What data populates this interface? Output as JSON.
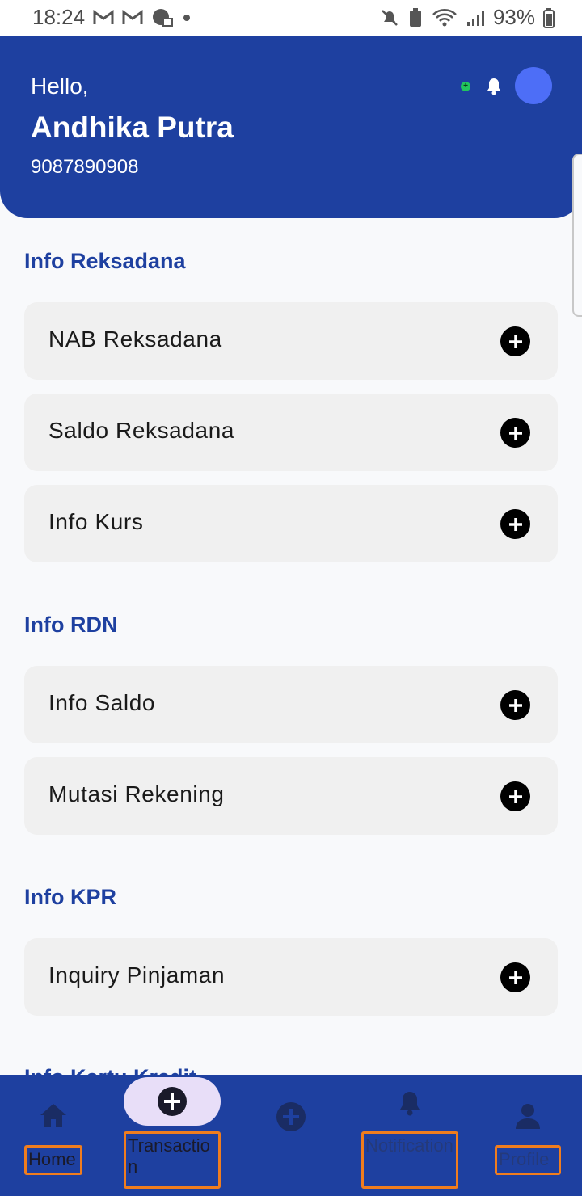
{
  "status_bar": {
    "time": "18:24",
    "battery": "93%",
    "left_icons": [
      "gmail-icon",
      "gmail-icon",
      "chat-icon",
      "dot-icon"
    ],
    "right_icons": [
      "mute-icon",
      "battery-saver-icon",
      "wifi-icon",
      "signal-icon",
      "battery-icon"
    ]
  },
  "header": {
    "greeting": "Hello,",
    "user_name": "Andhika Putra",
    "account_number": "9087890908",
    "colors": {
      "background": "#1e40a0",
      "avatar": "#4d6ef7",
      "online_dot": "#22c55e"
    }
  },
  "sections": [
    {
      "title": "Info Reksadana",
      "items": [
        "NAB Reksadana",
        "Saldo Reksadana",
        "Info Kurs"
      ]
    },
    {
      "title": "Info RDN",
      "items": [
        "Info Saldo",
        "Mutasi Rekening"
      ]
    },
    {
      "title": "Info KPR",
      "items": [
        "Inquiry Pinjaman"
      ]
    },
    {
      "title": "Info Kartu Kredit",
      "items": []
    }
  ],
  "bottom_nav": {
    "items": [
      {
        "label": "Home",
        "icon": "home-icon"
      },
      {
        "label": "Transaction",
        "icon": "add-circle-icon",
        "active": true
      },
      {
        "label": "",
        "icon": "add-circle-icon"
      },
      {
        "label": "Notification",
        "icon": "bell-icon"
      },
      {
        "label": "Profile",
        "icon": "person-icon"
      }
    ]
  }
}
